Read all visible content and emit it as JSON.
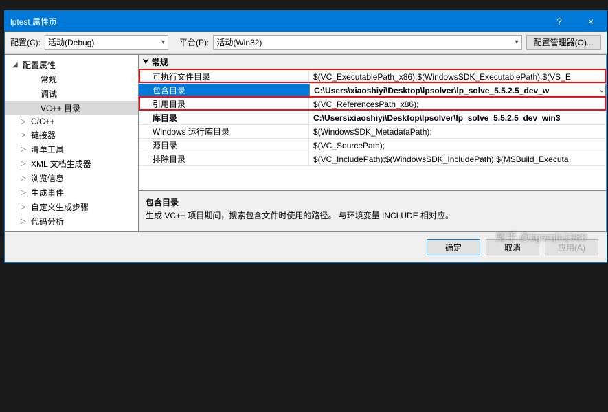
{
  "window": {
    "title": "lptest 属性页",
    "help": "?",
    "close": "×"
  },
  "toolbar": {
    "config_label": "配置(C):",
    "config_value": "活动(Debug)",
    "platform_label": "平台(P):",
    "platform_value": "活动(Win32)",
    "manager_btn": "配置管理器(O)..."
  },
  "tree": {
    "root": "配置属性",
    "items": [
      {
        "label": "常规",
        "depth": 2,
        "exp": ""
      },
      {
        "label": "调试",
        "depth": 2,
        "exp": ""
      },
      {
        "label": "VC++ 目录",
        "depth": 2,
        "exp": "",
        "selected": true
      },
      {
        "label": "C/C++",
        "depth": 1,
        "exp": "▷"
      },
      {
        "label": "链接器",
        "depth": 1,
        "exp": "▷"
      },
      {
        "label": "清单工具",
        "depth": 1,
        "exp": "▷"
      },
      {
        "label": "XML 文档生成器",
        "depth": 1,
        "exp": "▷"
      },
      {
        "label": "浏览信息",
        "depth": 1,
        "exp": "▷"
      },
      {
        "label": "生成事件",
        "depth": 1,
        "exp": "▷"
      },
      {
        "label": "自定义生成步骤",
        "depth": 1,
        "exp": "▷"
      },
      {
        "label": "代码分析",
        "depth": 1,
        "exp": "▷"
      }
    ]
  },
  "grid": {
    "group": "常规",
    "rows": [
      {
        "name": "可执行文件目录",
        "value": "$(VC_ExecutablePath_x86);$(WindowsSDK_ExecutablePath);$(VS_E"
      },
      {
        "name": "包含目录",
        "value": "C:\\Users\\xiaoshiyi\\Desktop\\lpsolver\\lp_solve_5.5.2.5_dev_w",
        "selected": true
      },
      {
        "name": "引用目录",
        "value": "$(VC_ReferencesPath_x86);"
      },
      {
        "name": "库目录",
        "value": "C:\\Users\\xiaoshiyi\\Desktop\\lpsolver\\lp_solve_5.5.2.5_dev_win3",
        "hl": true
      },
      {
        "name": "Windows 运行库目录",
        "value": "$(WindowsSDK_MetadataPath);"
      },
      {
        "name": "源目录",
        "value": "$(VC_SourcePath);"
      },
      {
        "name": "排除目录",
        "value": "$(VC_IncludePath);$(WindowsSDK_IncludePath);$(MSBuild_Executa"
      }
    ]
  },
  "desc": {
    "title": "包含目录",
    "text": "生成 VC++ 项目期间，搜索包含文件时使用的路径。 与环境变量 INCLUDE 相对应。"
  },
  "footer": {
    "ok": "确定",
    "cancel": "取消",
    "apply": "应用(A)"
  },
  "watermark": "知乎 @tigerqin1980"
}
